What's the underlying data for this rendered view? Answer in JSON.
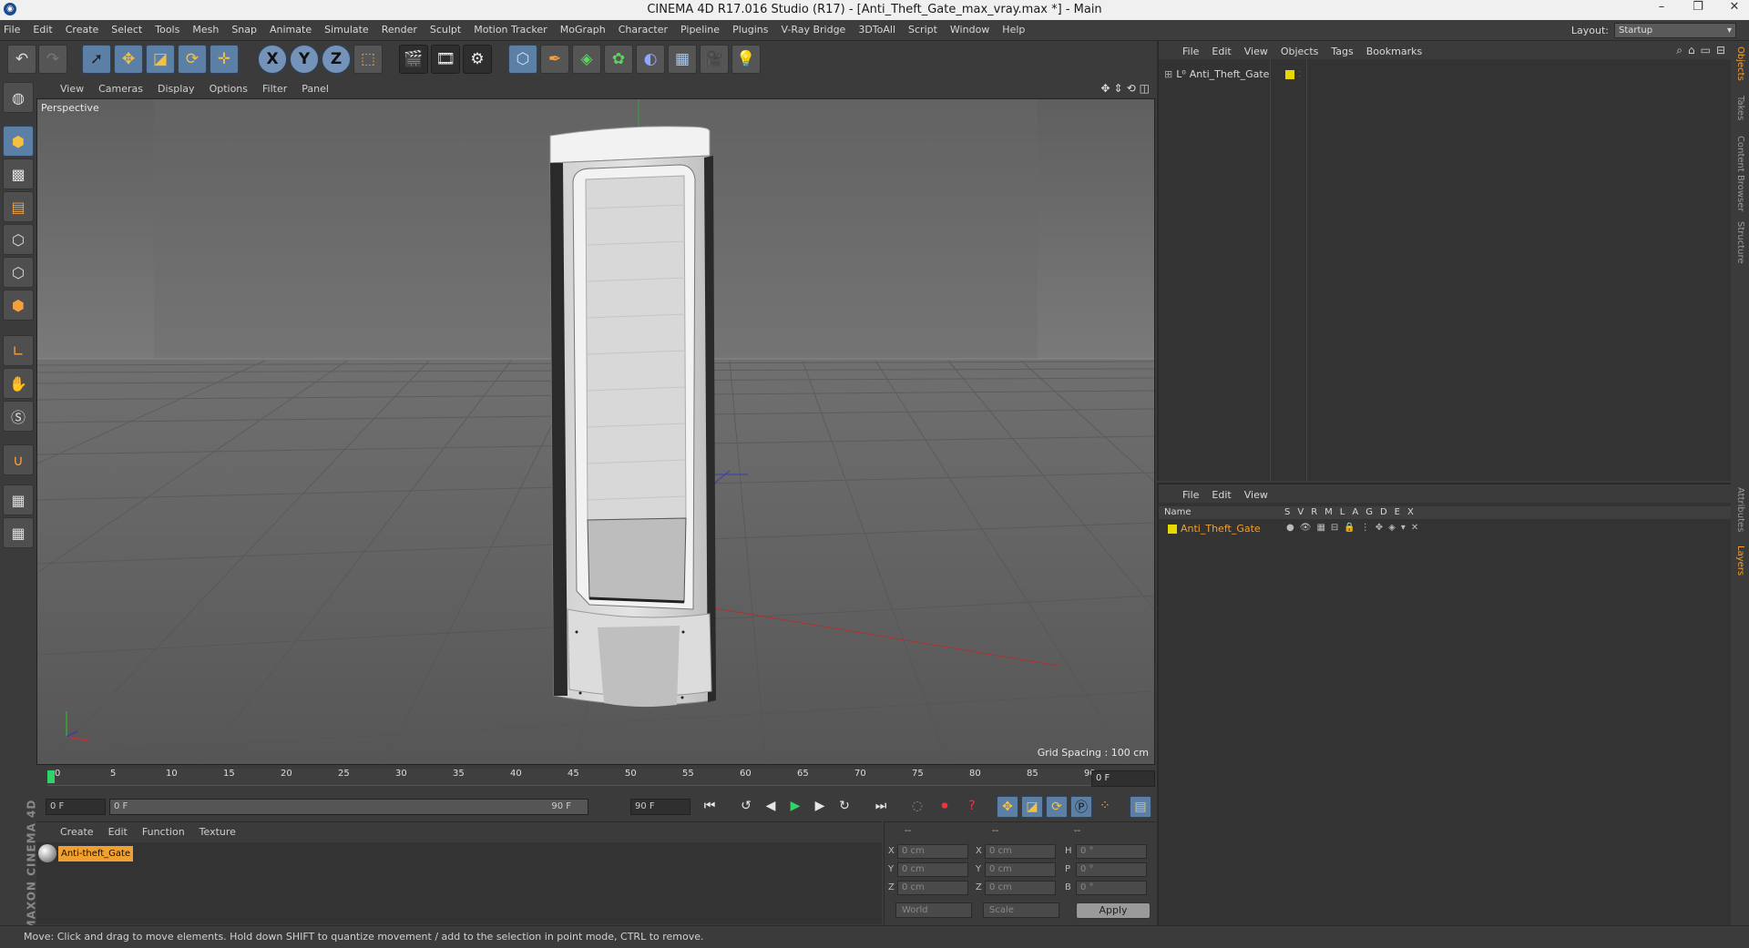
{
  "window": {
    "title": "CINEMA 4D R17.016 Studio (R17) - [Anti_Theft_Gate_max_vray.max *] - Main",
    "controls": [
      "–",
      "❐",
      "✕"
    ]
  },
  "menubar": {
    "items": [
      "File",
      "Edit",
      "Create",
      "Select",
      "Tools",
      "Mesh",
      "Snap",
      "Animate",
      "Simulate",
      "Render",
      "Sculpt",
      "Motion Tracker",
      "MoGraph",
      "Character",
      "Pipeline",
      "Plugins",
      "V-Ray Bridge",
      "3DToAll",
      "Script",
      "Window",
      "Help"
    ],
    "layout_label": "Layout:",
    "layout_value": "Startup"
  },
  "toolbar": {
    "axis_x": "X",
    "axis_y": "Y",
    "axis_z": "Z"
  },
  "viewport": {
    "menu": [
      "View",
      "Cameras",
      "Display",
      "Options",
      "Filter",
      "Panel"
    ],
    "label": "Perspective",
    "grid_spacing": "Grid Spacing : 100 cm"
  },
  "timeline": {
    "ticks": [
      "0",
      "5",
      "10",
      "15",
      "20",
      "25",
      "30",
      "35",
      "40",
      "45",
      "50",
      "55",
      "60",
      "65",
      "70",
      "75",
      "80",
      "85",
      "90"
    ],
    "current_frame": "0 F",
    "start_field": "0 F",
    "slider_start": "0 F",
    "slider_end": "90 F",
    "end_field": "90 F"
  },
  "material_manager": {
    "menu": [
      "Create",
      "Edit",
      "Function",
      "Texture"
    ],
    "material_name": "Anti-theft_Gate"
  },
  "coordinates": {
    "col_headers": [
      "--",
      "--",
      "--"
    ],
    "rows": [
      {
        "l1": "X",
        "v1": "0 cm",
        "l2": "X",
        "v2": "0 cm",
        "l3": "H",
        "v3": "0 °"
      },
      {
        "l1": "Y",
        "v1": "0 cm",
        "l2": "Y",
        "v2": "0 cm",
        "l3": "P",
        "v3": "0 °"
      },
      {
        "l1": "Z",
        "v1": "0 cm",
        "l2": "Z",
        "v2": "0 cm",
        "l3": "B",
        "v3": "0 °"
      }
    ],
    "space_dropdown": "World",
    "mode_dropdown": "Scale",
    "apply_label": "Apply"
  },
  "object_manager": {
    "menu": [
      "File",
      "Edit",
      "View",
      "Objects",
      "Tags",
      "Bookmarks"
    ],
    "object_name": "Anti_Theft_Gate",
    "object_color": "#e8d800"
  },
  "layer_manager": {
    "menu": [
      "File",
      "Edit",
      "View"
    ],
    "header_name": "Name",
    "columns": [
      "S",
      "V",
      "R",
      "M",
      "L",
      "A",
      "G",
      "D",
      "E",
      "X"
    ],
    "layer_name": "Anti_Theft_Gate",
    "layer_color": "#e8d800"
  },
  "side_tabs": [
    "Objects",
    "Takes",
    "Content Browser",
    "Structure",
    "Attributes",
    "Layers"
  ],
  "status": {
    "text": "Move: Click and drag to move elements. Hold down SHIFT to quantize movement / add to the selection in point mode, CTRL to remove."
  },
  "maxon_logo": "MAXON CINEMA 4D"
}
